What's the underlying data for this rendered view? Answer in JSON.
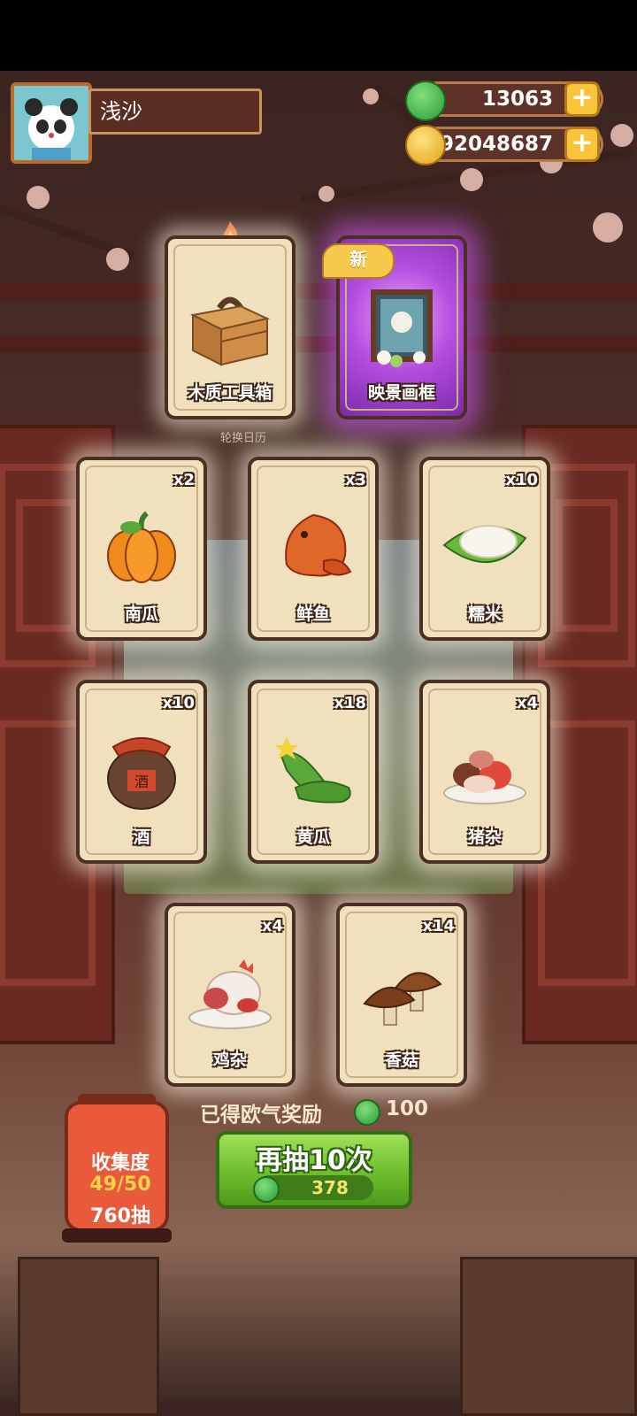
{
  "player": {
    "name": "浅沙"
  },
  "resources": {
    "jade": {
      "value": "13063",
      "icon": "jade-icon"
    },
    "coins": {
      "value": "92048687",
      "icon": "coin-icon"
    }
  },
  "top_cards": [
    {
      "label": "木质工具箱",
      "icon": "toolbox-icon",
      "special": false
    },
    {
      "label": "映景画框",
      "icon": "picture-frame-icon",
      "special": true,
      "badge": "新"
    }
  ],
  "calendar_label": "轮换日历",
  "cards": [
    {
      "label": "南瓜",
      "qty": "x2",
      "icon": "pumpkin-icon"
    },
    {
      "label": "鲜鱼",
      "qty": "x3",
      "icon": "fish-icon"
    },
    {
      "label": "糯米",
      "qty": "x10",
      "icon": "rice-icon"
    },
    {
      "label": "酒",
      "qty": "x10",
      "icon": "wine-jar-icon"
    },
    {
      "label": "黄瓜",
      "qty": "x18",
      "icon": "cucumber-icon"
    },
    {
      "label": "猪杂",
      "qty": "x4",
      "icon": "pork-offal-icon"
    },
    {
      "label": "鸡杂",
      "qty": "x4",
      "icon": "chicken-offal-icon"
    },
    {
      "label": "香菇",
      "qty": "x14",
      "icon": "mushroom-icon"
    }
  ],
  "wine_char": "酒",
  "reward": {
    "label": "已得欧气奖励",
    "value": "100"
  },
  "draw_button": {
    "label": "再抽10次",
    "cost": "378"
  },
  "collection": {
    "title": "收集度",
    "progress": "49/50",
    "draws": "760抽"
  },
  "colors": {
    "accent_green": "#6cbd2c",
    "card_bg": "#f1e0bd",
    "card_border": "#4b2f22",
    "gold": "#f7c43a"
  }
}
